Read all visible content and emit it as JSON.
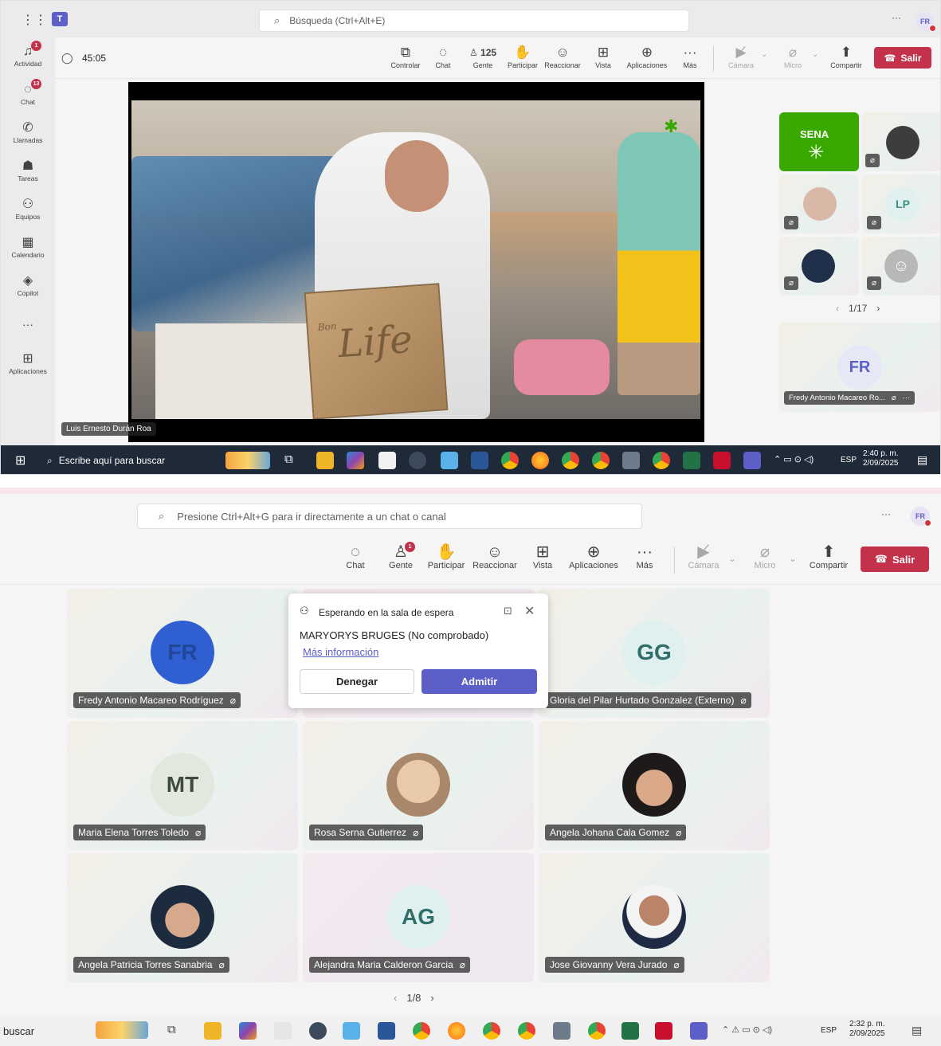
{
  "shot1": {
    "search": "Búsqueda (Ctrl+Alt+E)",
    "user_initials": "FR",
    "more": "···",
    "timer": "45:05",
    "rail": [
      {
        "label": "Actividad",
        "badge": "1"
      },
      {
        "label": "Chat",
        "badge": "13"
      },
      {
        "label": "Llamadas",
        "badge": ""
      },
      {
        "label": "Tareas",
        "badge": ""
      },
      {
        "label": "Equipos",
        "badge": ""
      },
      {
        "label": "Calendario",
        "badge": ""
      },
      {
        "label": "Copilot",
        "badge": ""
      },
      {
        "label": "···",
        "badge": ""
      },
      {
        "label": "Aplicaciones",
        "badge": ""
      }
    ],
    "toolbar": {
      "controlar": "Controlar",
      "chat": "Chat",
      "people_count": "125",
      "gente": "Gente",
      "participar": "Participar",
      "reaccionar": "Reaccionar",
      "vista": "Vista",
      "aplicaciones": "Aplicaciones",
      "mas": "Más",
      "camara": "Cámara",
      "micro": "Micro",
      "compartir": "Compartir",
      "salir": "Salir"
    },
    "stage": {
      "presenter": "Luis Ernesto Durán Roa",
      "box_text": "Life",
      "box_brand": "Bon"
    },
    "tiles": {
      "sena": "SENA",
      "lp": "LP",
      "pager": "1/17",
      "self_initials": "FR",
      "self_name": "Fredy Antonio Macareo Ro..."
    },
    "taskbar": {
      "search": "Escribe aquí para buscar",
      "lang": "ESP",
      "time": "2:40 p. m.",
      "date": "2/09/2025"
    }
  },
  "shot2": {
    "search": "Presione Ctrl+Alt+G para ir directamente a un chat o canal",
    "user_initials": "FR",
    "more": "···",
    "toolbar": {
      "chat": "Chat",
      "gente": "Gente",
      "gente_badge": "1",
      "participar": "Participar",
      "reaccionar": "Reaccionar",
      "vista": "Vista",
      "aplicaciones": "Aplicaciones",
      "mas": "Más",
      "camara": "Cámara",
      "micro": "Micro",
      "compartir": "Compartir",
      "salir": "Salir"
    },
    "lobby": {
      "title": "Esperando en la sala de espera",
      "person": "MARYORYS BRUGES (No comprobado)",
      "link": "Más información",
      "deny": "Denegar",
      "admit": "Admitir"
    },
    "participants": [
      {
        "name": "Fredy Antonio Macareo Rodríguez",
        "initials": "FR"
      },
      {
        "name": "",
        "initials": ""
      },
      {
        "name": "Gloria del Pilar Hurtado Gonzalez (Externo)",
        "initials": "GG"
      },
      {
        "name": "Maria Elena Torres Toledo",
        "initials": "MT"
      },
      {
        "name": "Rosa Serna Gutierrez",
        "initials": ""
      },
      {
        "name": "Angela Johana Cala Gomez",
        "initials": ""
      },
      {
        "name": "Angela Patricia Torres Sanabria",
        "initials": ""
      },
      {
        "name": "Alejandra Maria Calderon Garcia",
        "initials": "AG"
      },
      {
        "name": "Jose Giovanny Vera Jurado",
        "initials": ""
      }
    ],
    "pager": "1/8",
    "taskbar": {
      "search": "buscar",
      "lang": "ESP",
      "time": "2:32 p. m.",
      "date": "2/09/2025"
    }
  },
  "colors": {
    "accent": "#5b5fc7",
    "leave": "#c4314b",
    "badge": "#c4314b",
    "sena_green": "#39a900",
    "taskbar": "#1f2a38"
  }
}
